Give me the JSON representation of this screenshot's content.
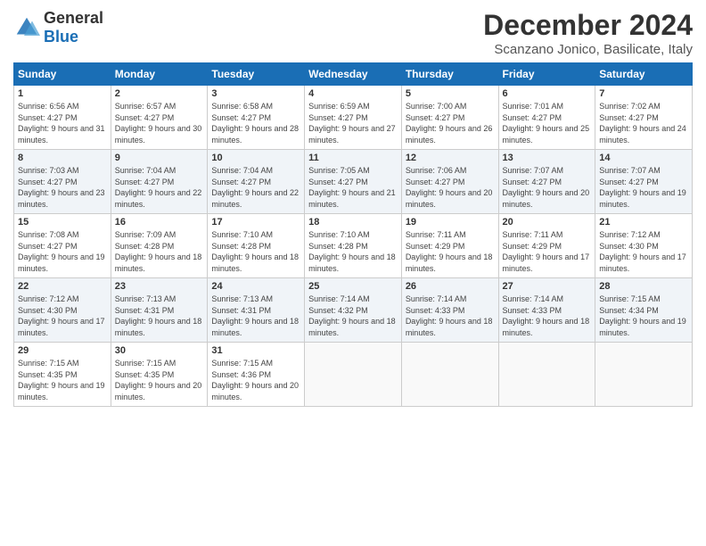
{
  "header": {
    "logo_general": "General",
    "logo_blue": "Blue",
    "title": "December 2024",
    "subtitle": "Scanzano Jonico, Basilicate, Italy"
  },
  "days_of_week": [
    "Sunday",
    "Monday",
    "Tuesday",
    "Wednesday",
    "Thursday",
    "Friday",
    "Saturday"
  ],
  "weeks": [
    [
      {
        "day": "1",
        "sunrise": "6:56 AM",
        "sunset": "4:27 PM",
        "daylight": "9 hours and 31 minutes."
      },
      {
        "day": "2",
        "sunrise": "6:57 AM",
        "sunset": "4:27 PM",
        "daylight": "9 hours and 30 minutes."
      },
      {
        "day": "3",
        "sunrise": "6:58 AM",
        "sunset": "4:27 PM",
        "daylight": "9 hours and 28 minutes."
      },
      {
        "day": "4",
        "sunrise": "6:59 AM",
        "sunset": "4:27 PM",
        "daylight": "9 hours and 27 minutes."
      },
      {
        "day": "5",
        "sunrise": "7:00 AM",
        "sunset": "4:27 PM",
        "daylight": "9 hours and 26 minutes."
      },
      {
        "day": "6",
        "sunrise": "7:01 AM",
        "sunset": "4:27 PM",
        "daylight": "9 hours and 25 minutes."
      },
      {
        "day": "7",
        "sunrise": "7:02 AM",
        "sunset": "4:27 PM",
        "daylight": "9 hours and 24 minutes."
      }
    ],
    [
      {
        "day": "8",
        "sunrise": "7:03 AM",
        "sunset": "4:27 PM",
        "daylight": "9 hours and 23 minutes."
      },
      {
        "day": "9",
        "sunrise": "7:04 AM",
        "sunset": "4:27 PM",
        "daylight": "9 hours and 22 minutes."
      },
      {
        "day": "10",
        "sunrise": "7:04 AM",
        "sunset": "4:27 PM",
        "daylight": "9 hours and 22 minutes."
      },
      {
        "day": "11",
        "sunrise": "7:05 AM",
        "sunset": "4:27 PM",
        "daylight": "9 hours and 21 minutes."
      },
      {
        "day": "12",
        "sunrise": "7:06 AM",
        "sunset": "4:27 PM",
        "daylight": "9 hours and 20 minutes."
      },
      {
        "day": "13",
        "sunrise": "7:07 AM",
        "sunset": "4:27 PM",
        "daylight": "9 hours and 20 minutes."
      },
      {
        "day": "14",
        "sunrise": "7:07 AM",
        "sunset": "4:27 PM",
        "daylight": "9 hours and 19 minutes."
      }
    ],
    [
      {
        "day": "15",
        "sunrise": "7:08 AM",
        "sunset": "4:27 PM",
        "daylight": "9 hours and 19 minutes."
      },
      {
        "day": "16",
        "sunrise": "7:09 AM",
        "sunset": "4:28 PM",
        "daylight": "9 hours and 18 minutes."
      },
      {
        "day": "17",
        "sunrise": "7:10 AM",
        "sunset": "4:28 PM",
        "daylight": "9 hours and 18 minutes."
      },
      {
        "day": "18",
        "sunrise": "7:10 AM",
        "sunset": "4:28 PM",
        "daylight": "9 hours and 18 minutes."
      },
      {
        "day": "19",
        "sunrise": "7:11 AM",
        "sunset": "4:29 PM",
        "daylight": "9 hours and 18 minutes."
      },
      {
        "day": "20",
        "sunrise": "7:11 AM",
        "sunset": "4:29 PM",
        "daylight": "9 hours and 17 minutes."
      },
      {
        "day": "21",
        "sunrise": "7:12 AM",
        "sunset": "4:30 PM",
        "daylight": "9 hours and 17 minutes."
      }
    ],
    [
      {
        "day": "22",
        "sunrise": "7:12 AM",
        "sunset": "4:30 PM",
        "daylight": "9 hours and 17 minutes."
      },
      {
        "day": "23",
        "sunrise": "7:13 AM",
        "sunset": "4:31 PM",
        "daylight": "9 hours and 18 minutes."
      },
      {
        "day": "24",
        "sunrise": "7:13 AM",
        "sunset": "4:31 PM",
        "daylight": "9 hours and 18 minutes."
      },
      {
        "day": "25",
        "sunrise": "7:14 AM",
        "sunset": "4:32 PM",
        "daylight": "9 hours and 18 minutes."
      },
      {
        "day": "26",
        "sunrise": "7:14 AM",
        "sunset": "4:33 PM",
        "daylight": "9 hours and 18 minutes."
      },
      {
        "day": "27",
        "sunrise": "7:14 AM",
        "sunset": "4:33 PM",
        "daylight": "9 hours and 18 minutes."
      },
      {
        "day": "28",
        "sunrise": "7:15 AM",
        "sunset": "4:34 PM",
        "daylight": "9 hours and 19 minutes."
      }
    ],
    [
      {
        "day": "29",
        "sunrise": "7:15 AM",
        "sunset": "4:35 PM",
        "daylight": "9 hours and 19 minutes."
      },
      {
        "day": "30",
        "sunrise": "7:15 AM",
        "sunset": "4:35 PM",
        "daylight": "9 hours and 20 minutes."
      },
      {
        "day": "31",
        "sunrise": "7:15 AM",
        "sunset": "4:36 PM",
        "daylight": "9 hours and 20 minutes."
      },
      null,
      null,
      null,
      null
    ]
  ]
}
